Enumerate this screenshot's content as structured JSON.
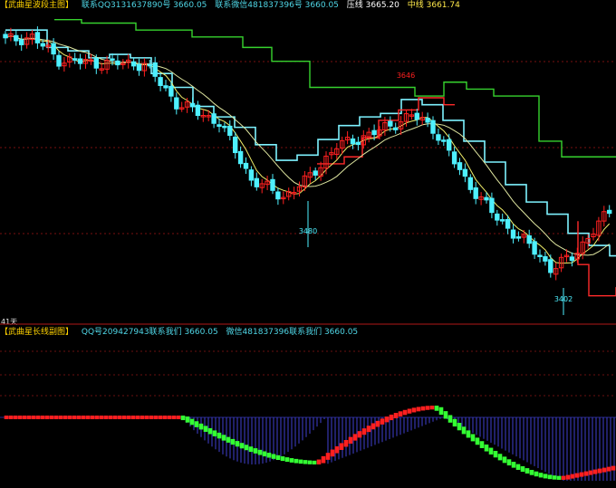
{
  "header_main": {
    "title": "【武曲星波段主图】",
    "contact_qq": "联系QQ3131637890号 3660.05",
    "contact_wechat": "联系微信481837396号 3660.05",
    "pressure": "压线 3665.20",
    "midline": "中线 3661.74"
  },
  "header_sub": {
    "title": "【武曲星长线副图】",
    "qq": "QQ号209427943联系我们 3660.05",
    "wechat": "微信481837396联系我们 3660.05"
  },
  "left_label": "41天",
  "colors": {
    "background": "#000000",
    "up_candle": "#ff2020",
    "down_candle": "#4ef0ff",
    "resistance": "#36d22e",
    "support": "#ff2a2a",
    "cyan_channel": "#7ef2ff",
    "ma_short": "#f0ee6a",
    "ma_long": "#dfe6a0",
    "bar_up": "#ff1f1f",
    "bar_down": "#33ff33",
    "bar_neg": "#4040d0"
  },
  "chart_data": [
    {
      "type": "candlestick",
      "title": "",
      "annotations": [
        {
          "text": "3646",
          "value": 3646
        },
        {
          "text": "3480",
          "value": 3480
        },
        {
          "text": "3402",
          "value": 3402
        }
      ],
      "ylim": [
        3376,
        3720
      ]
    },
    {
      "type": "bar",
      "title": "",
      "note": "oscillator histogram"
    }
  ]
}
